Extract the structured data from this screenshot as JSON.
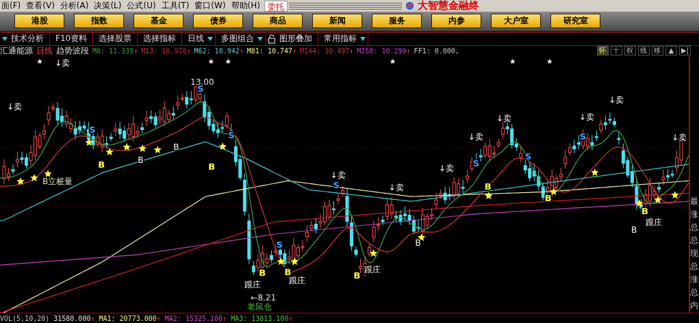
{
  "menu": [
    {
      "label": "面(F)"
    },
    {
      "label": "查看(V)"
    },
    {
      "label": "分析(A)"
    },
    {
      "label": "决策(L)"
    },
    {
      "label": "公式(U)"
    },
    {
      "label": "工具(T)"
    },
    {
      "label": "窗口(W)"
    },
    {
      "label": "帮助(H)"
    }
  ],
  "trade_button": "委托",
  "window": {
    "title": "大智慧金融终"
  },
  "nav": [
    {
      "label": "港股"
    },
    {
      "label": "指数"
    },
    {
      "label": "基金"
    },
    {
      "label": "债券"
    },
    {
      "label": "商品"
    },
    {
      "label": "新闻"
    },
    {
      "label": "服务"
    },
    {
      "label": "内参"
    },
    {
      "label": "大户室"
    },
    {
      "label": "研究室"
    }
  ],
  "toolbar": [
    {
      "kind": "dropdown",
      "label": "技术分析"
    },
    {
      "kind": "plain",
      "label": "F10资料"
    },
    {
      "kind": "plain",
      "label": "选择股票"
    },
    {
      "kind": "plain",
      "label": "选择指标"
    },
    {
      "kind": "dropdown_after",
      "label": "日线"
    },
    {
      "kind": "dropdown_after",
      "label": "多图组合"
    },
    {
      "kind": "lock",
      "label": "图形叠加"
    },
    {
      "kind": "dropdown_after",
      "label": "常用指标"
    }
  ],
  "indicator": {
    "stock": "汇通能源",
    "period": "日线",
    "name": "趋势波段",
    "values": [
      {
        "label": "M8:",
        "value": "11.339",
        "arrow": "↑",
        "color": "#3a9a3a"
      },
      {
        "label": "M13:",
        "value": "10.978",
        "arrow": "↑",
        "color": "#c03030"
      },
      {
        "label": "M62:",
        "value": "10.942",
        "arrow": "↑",
        "color": "#5fc8d0"
      },
      {
        "label": "M81:",
        "value": "10.747",
        "arrow": "↑",
        "color": "#f0f080"
      },
      {
        "label": "M144:",
        "value": "10.497",
        "arrow": "↑",
        "color": "#c03030"
      },
      {
        "label": "M250:",
        "value": "10.299",
        "arrow": "↑",
        "color": "#c040c0"
      },
      {
        "label": "FF1:",
        "value": "0.000,",
        "color": "#c8c8c8"
      }
    ]
  },
  "view_buttons": [
    {
      "label": "怀",
      "selected": true
    },
    {
      "label": "十",
      "selected": false
    },
    {
      "label": "权",
      "selected": false
    },
    {
      "label": "线",
      "selected": false
    },
    {
      "label": "移",
      "selected": false
    },
    {
      "label": "▲",
      "selected": false
    },
    {
      "label": "▶|",
      "selected": false
    }
  ],
  "chart_labels": [
    {
      "kind": "sell",
      "text": "↓卖"
    },
    {
      "kind": "sell",
      "text": "↓卖"
    },
    {
      "kind": "note",
      "text": "13.00"
    },
    {
      "kind": "sell",
      "text": "↓卖"
    },
    {
      "kind": "sell",
      "text": "↓卖"
    },
    {
      "kind": "sell",
      "text": "↓卖"
    },
    {
      "kind": "sell",
      "text": "↓卖"
    },
    {
      "kind": "sell",
      "text": "↓卖"
    },
    {
      "kind": "sell",
      "text": "↓卖"
    },
    {
      "kind": "sell",
      "text": "↓卖"
    },
    {
      "kind": "sell",
      "text": "↓卖"
    },
    {
      "kind": "s",
      "text": "S"
    },
    {
      "kind": "s",
      "text": "S"
    },
    {
      "kind": "s",
      "text": "S"
    },
    {
      "kind": "s",
      "text": "S"
    },
    {
      "kind": "s",
      "text": "S"
    },
    {
      "kind": "s",
      "text": "S"
    },
    {
      "kind": "s",
      "text": "S"
    },
    {
      "kind": "s",
      "text": "S"
    },
    {
      "kind": "b",
      "text": "B"
    },
    {
      "kind": "b",
      "text": "B"
    },
    {
      "kind": "b",
      "text": "B"
    },
    {
      "kind": "b",
      "text": "B"
    },
    {
      "kind": "b",
      "text": "B"
    },
    {
      "kind": "b",
      "text": "B"
    },
    {
      "kind": "b",
      "text": "B"
    },
    {
      "kind": "b",
      "text": "B"
    },
    {
      "kind": "b_plain",
      "text": "B"
    },
    {
      "kind": "b_plain",
      "text": "B"
    },
    {
      "kind": "b_plain",
      "text": "B"
    },
    {
      "kind": "b_plain",
      "text": "B"
    },
    {
      "kind": "follow",
      "text": "跟庄"
    },
    {
      "kind": "follow",
      "text": "跟庄"
    },
    {
      "kind": "follow",
      "text": "跟庄"
    },
    {
      "kind": "follow",
      "text": "跟庄"
    },
    {
      "kind": "pile",
      "text": "B立桩量"
    },
    {
      "kind": "note",
      "text": "←8.21"
    },
    {
      "kind": "rat",
      "text": "老鼠仓"
    }
  ],
  "side_labels": [
    "最",
    "涨",
    "总",
    "总",
    "现",
    "总",
    "涨",
    "总",
    "内"
  ],
  "volume": {
    "label": "VOL(5,10,20)",
    "values": [
      {
        "value": "31580.000",
        "arrow": "↑",
        "color": "#e0e0e0"
      },
      {
        "label": "MA1:",
        "value": "20773.000",
        "arrow": "↑",
        "color": "#f0f080"
      },
      {
        "label": "MA2:",
        "value": "15325.100",
        "arrow": "↑",
        "color": "#d040d0"
      },
      {
        "label": "MA3:",
        "value": "13813.100",
        "arrow": "↑",
        "color": "#40c040"
      }
    ]
  }
}
